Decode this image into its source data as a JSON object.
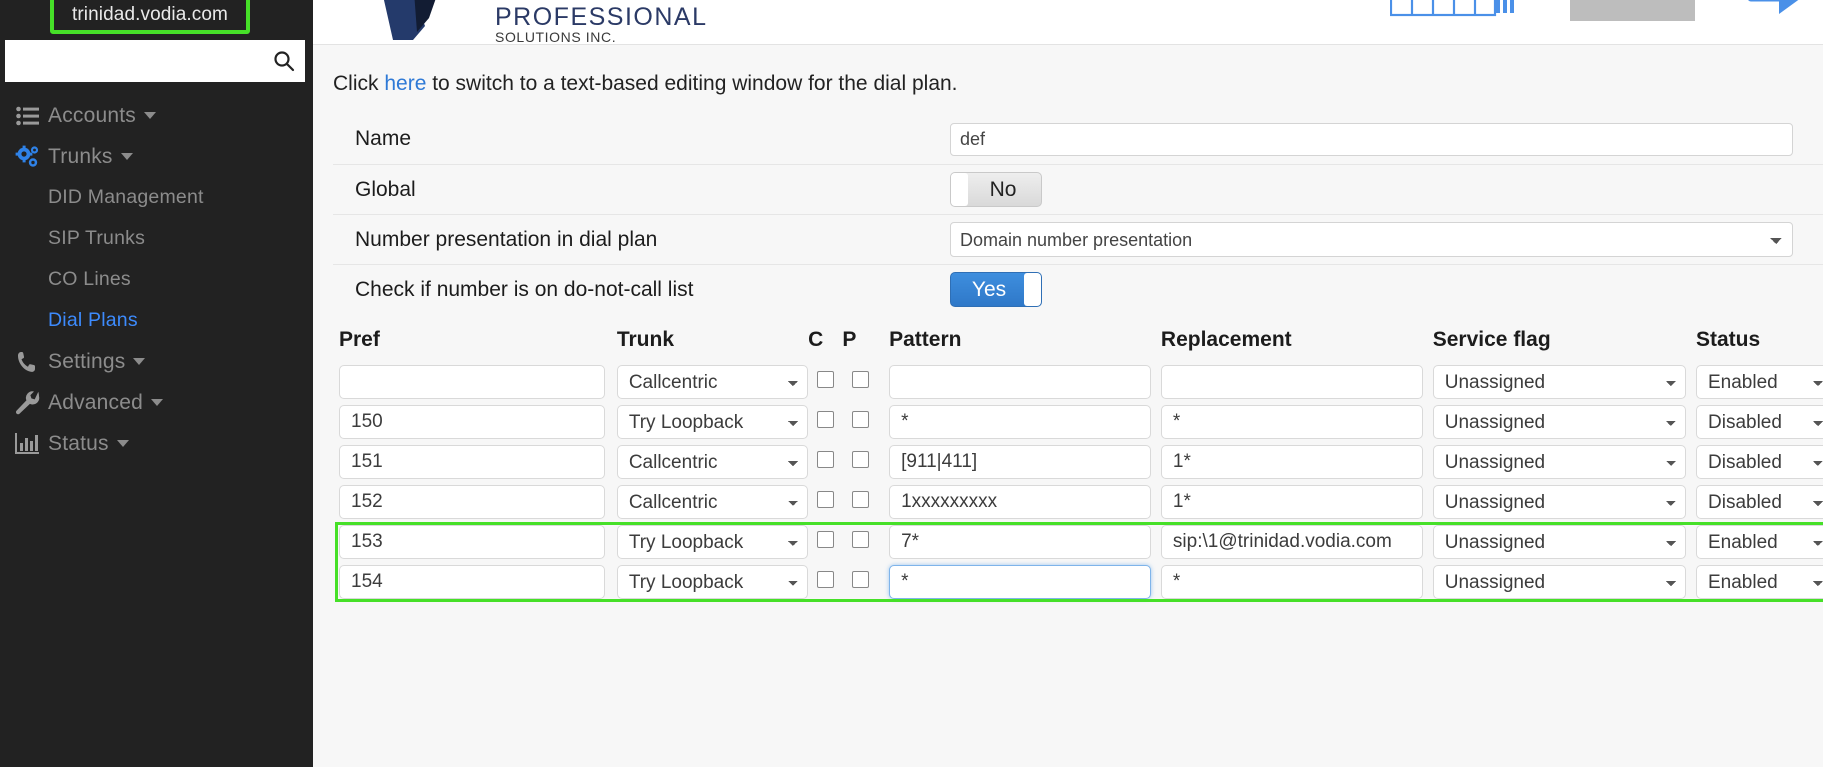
{
  "sidebar": {
    "domain_tooltip": "trinidad.vodia.com",
    "search": {
      "value": "",
      "placeholder": ""
    },
    "search_icon": "search-icon",
    "items": [
      {
        "label": "Accounts",
        "icon": "list-icon",
        "type": "group",
        "caret": true
      },
      {
        "label": "Trunks",
        "icon": "gears-icon",
        "type": "group",
        "caret": true,
        "expanded": true
      },
      {
        "label": "DID Management",
        "type": "sub",
        "active": false
      },
      {
        "label": "SIP Trunks",
        "type": "sub",
        "active": false
      },
      {
        "label": "CO Lines",
        "type": "sub",
        "active": false
      },
      {
        "label": "Dial Plans",
        "type": "sub",
        "active": true
      },
      {
        "label": "Settings",
        "icon": "phone-icon",
        "type": "group",
        "caret": true
      },
      {
        "label": "Advanced",
        "icon": "wrench-icon",
        "type": "group",
        "caret": true
      },
      {
        "label": "Status",
        "icon": "chart-icon",
        "type": "group",
        "caret": true
      }
    ]
  },
  "header": {
    "logo_line1": "PROFESSIONAL",
    "logo_line2": "SOLUTIONS INC.",
    "icons": [
      {
        "name": "table-grid-icon"
      },
      {
        "name": "gray-block-placeholder"
      },
      {
        "name": "logout-arrow-icon"
      }
    ]
  },
  "main": {
    "hint_before": "Click ",
    "hint_link": "here",
    "hint_after": " to switch to a text-based editing window for the dial plan.",
    "fields": {
      "name_label": "Name",
      "name_value": "def",
      "global_label": "Global",
      "global_value": "No",
      "presentation_label": "Number presentation in dial plan",
      "presentation_value": "Domain number presentation",
      "dnc_label": "Check if number is on do-not-call list",
      "dnc_value": "Yes"
    },
    "table": {
      "headers": [
        "Pref",
        "Trunk",
        "C",
        "P",
        "Pattern",
        "Replacement",
        "Service flag",
        "Status"
      ],
      "rows": [
        {
          "pref": "",
          "trunk": "Callcentric",
          "c": false,
          "p": false,
          "pattern": "",
          "replacement": "",
          "service_flag": "Unassigned",
          "status": "Enabled",
          "highlighted": false,
          "focused": false
        },
        {
          "pref": "150",
          "trunk": "Try Loopback",
          "c": false,
          "p": false,
          "pattern": "*",
          "replacement": "*",
          "service_flag": "Unassigned",
          "status": "Disabled",
          "highlighted": false,
          "focused": false
        },
        {
          "pref": "151",
          "trunk": "Callcentric",
          "c": false,
          "p": false,
          "pattern": "[911|411]",
          "replacement": "1*",
          "service_flag": "Unassigned",
          "status": "Disabled",
          "highlighted": false,
          "focused": false
        },
        {
          "pref": "152",
          "trunk": "Callcentric",
          "c": false,
          "p": false,
          "pattern": "1xxxxxxxxx",
          "replacement": "1*",
          "service_flag": "Unassigned",
          "status": "Disabled",
          "highlighted": false,
          "focused": false
        },
        {
          "pref": "153",
          "trunk": "Try Loopback",
          "c": false,
          "p": false,
          "pattern": "7*",
          "replacement": "sip:\\1@trinidad.vodia.com",
          "service_flag": "Unassigned",
          "status": "Enabled",
          "highlighted": true,
          "focused": false
        },
        {
          "pref": "154",
          "trunk": "Try Loopback",
          "c": false,
          "p": false,
          "pattern": "*",
          "replacement": "*",
          "service_flag": "Unassigned",
          "status": "Enabled",
          "highlighted": true,
          "focused": true
        }
      ]
    }
  },
  "colors": {
    "highlight_green": "#46e028",
    "link_blue": "#2e79d6",
    "accent_blue": "#3d8bfd",
    "toggle_on": "#3e8ede",
    "sidebar_bg": "#222222"
  }
}
